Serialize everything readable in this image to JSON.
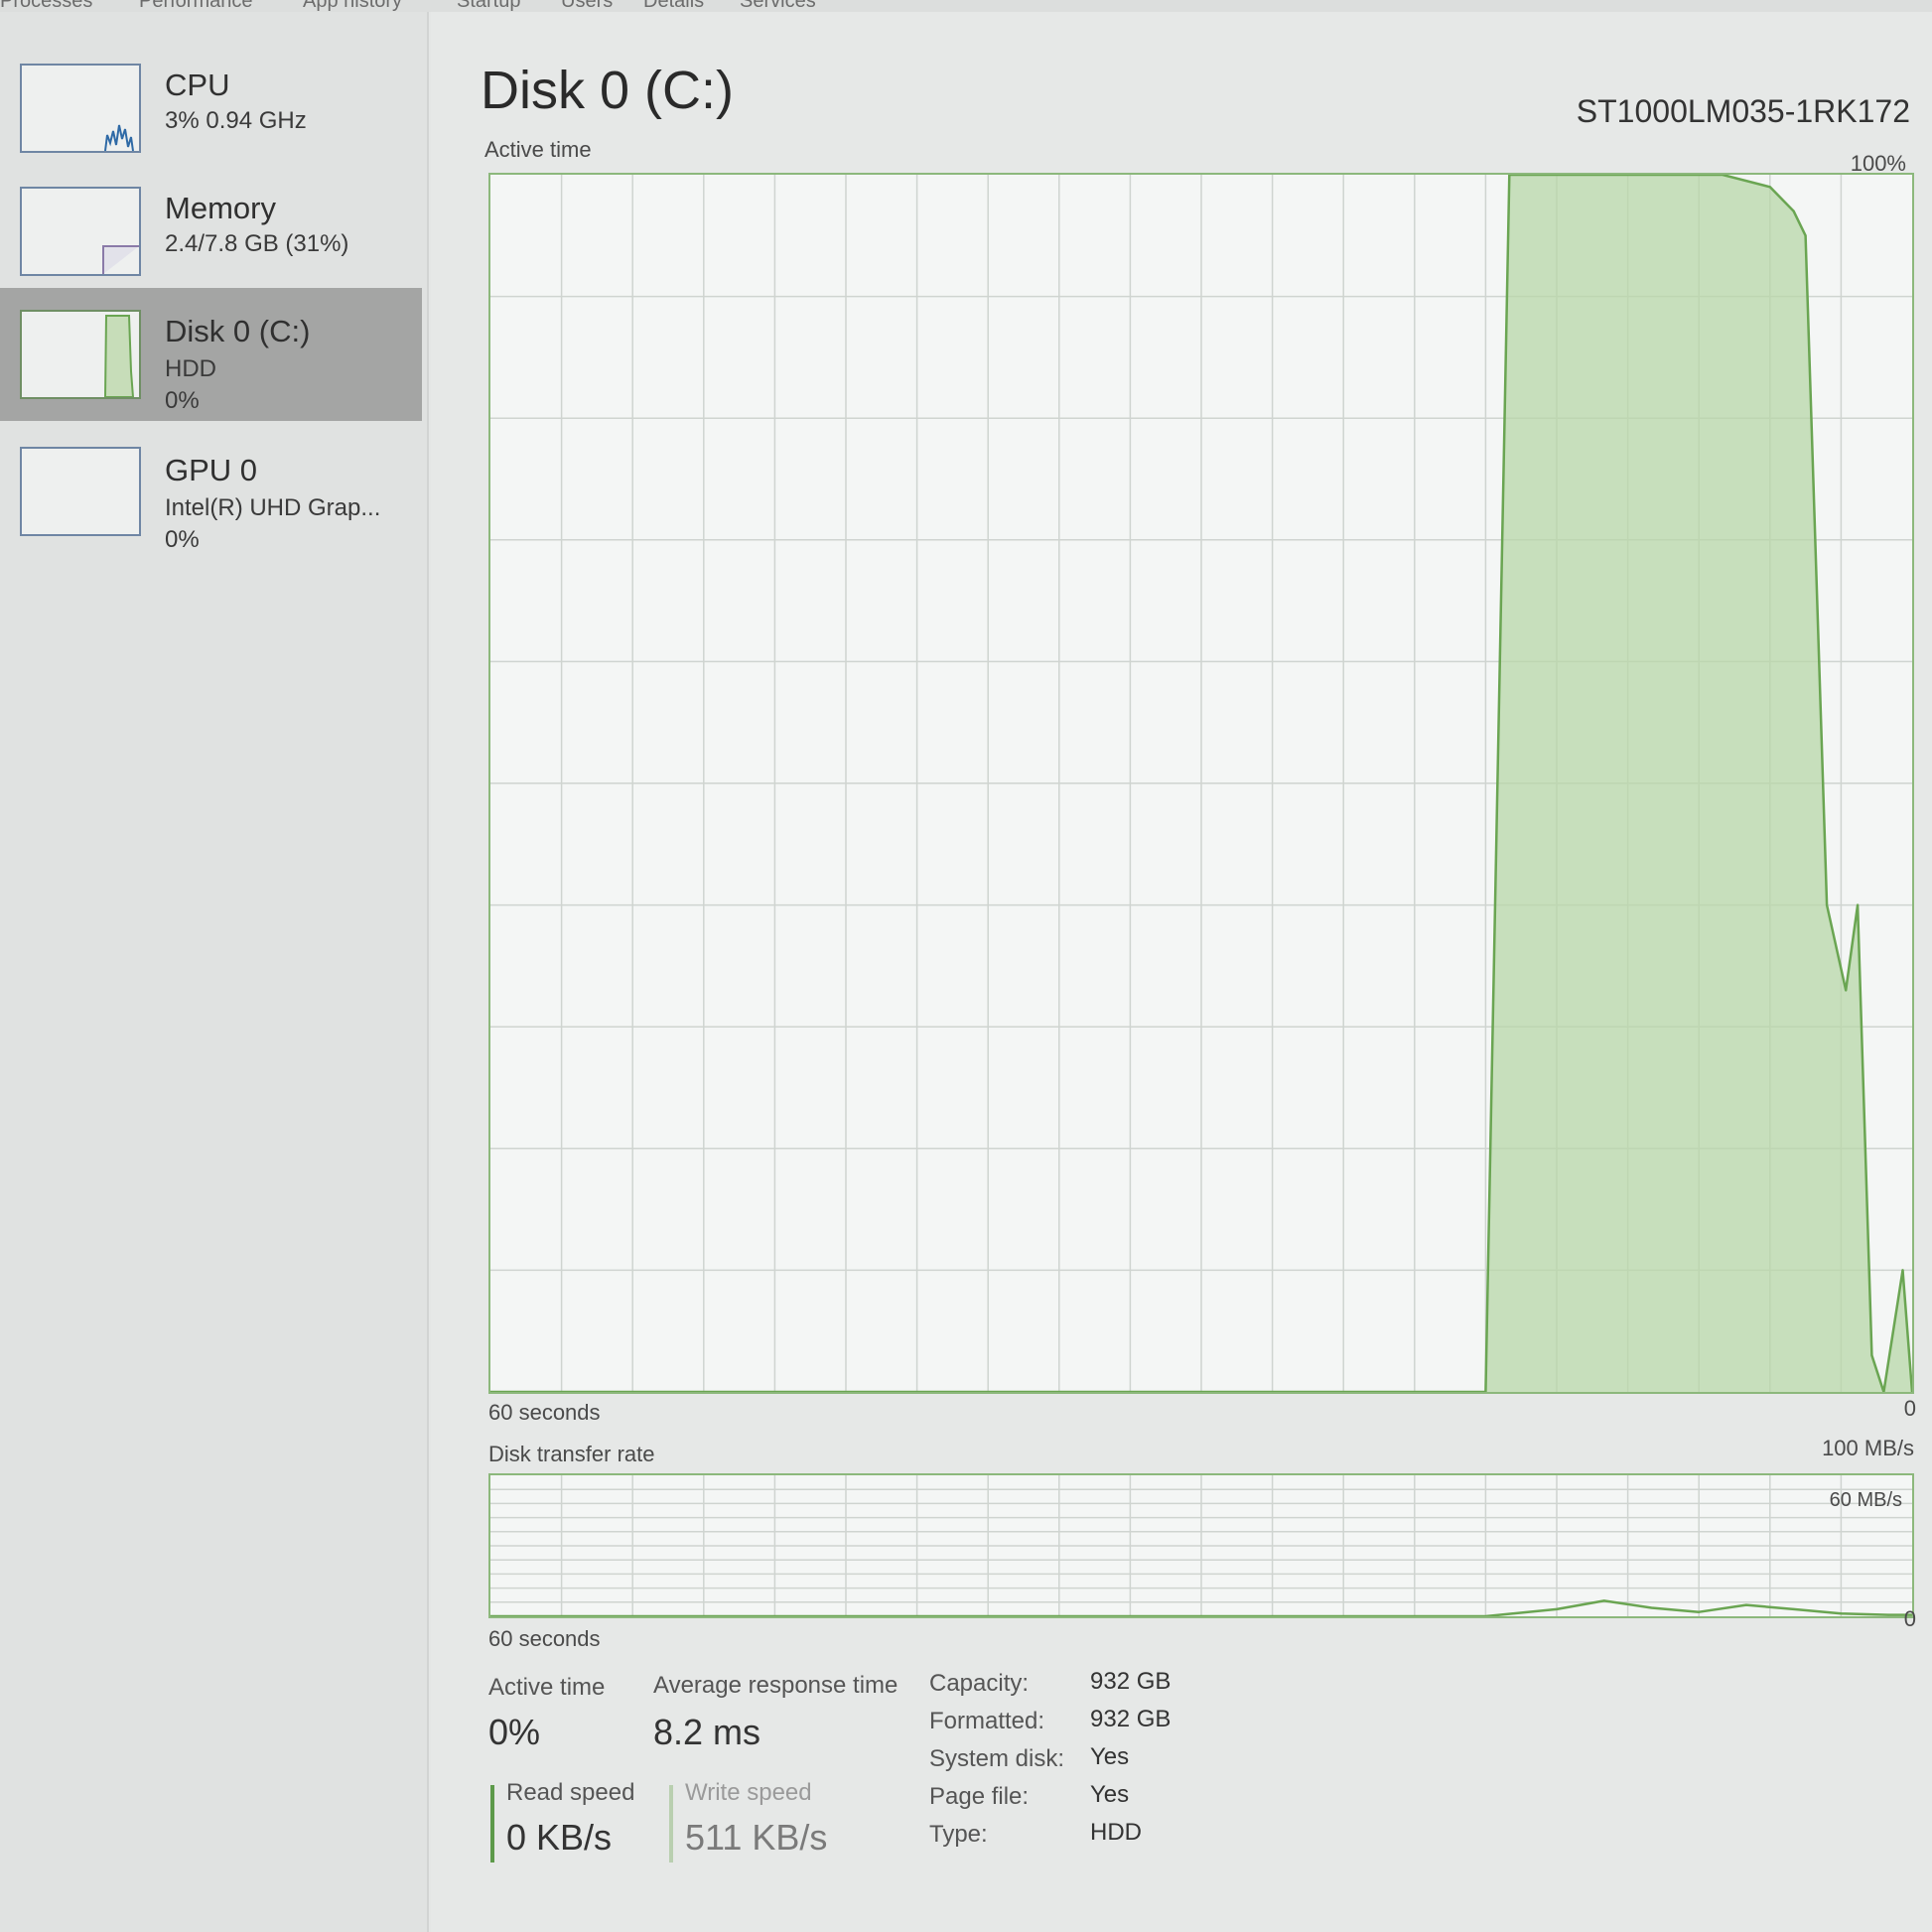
{
  "tabs": [
    "Processes",
    "Performance",
    "App history",
    "Startup",
    "Users",
    "Details",
    "Services"
  ],
  "sidebar": {
    "items": [
      {
        "title": "CPU",
        "sub1": "3% 0.94 GHz",
        "sub2": ""
      },
      {
        "title": "Memory",
        "sub1": "2.4/7.8 GB (31%)",
        "sub2": ""
      },
      {
        "title": "Disk 0 (C:)",
        "sub1": "HDD",
        "sub2": "0%"
      },
      {
        "title": "GPU 0",
        "sub1": "Intel(R) UHD Grap...",
        "sub2": "0%"
      }
    ],
    "selected_index": 2
  },
  "main": {
    "title": "Disk 0 (C:)",
    "model": "ST1000LM035-1RK172",
    "active_graph": {
      "label": "Active time",
      "max_label": "100%",
      "time_label": "60 seconds",
      "min_label": "0"
    },
    "transfer_graph": {
      "label": "Disk transfer rate",
      "max_label": "100 MB/s",
      "mid_label": "60 MB/s",
      "time_label": "60 seconds",
      "min_label": "0"
    }
  },
  "stats": {
    "active_time_label": "Active time",
    "active_time_value": "0%",
    "avg_response_label": "Average response time",
    "avg_response_value": "8.2 ms",
    "read_label": "Read speed",
    "read_value": "0 KB/s",
    "write_label": "Write speed",
    "write_value": "511 KB/s"
  },
  "properties": [
    {
      "key": "Capacity:",
      "value": "932 GB"
    },
    {
      "key": "Formatted:",
      "value": "932 GB"
    },
    {
      "key": "System disk:",
      "value": "Yes"
    },
    {
      "key": "Page file:",
      "value": "Yes"
    },
    {
      "key": "Type:",
      "value": "HDD"
    }
  ],
  "chart_data": [
    {
      "type": "area",
      "title": "Active time",
      "xlabel": "60 seconds",
      "ylabel": "",
      "xlim": [
        60,
        0
      ],
      "ylim": [
        0,
        100
      ],
      "grid": true,
      "x": [
        60,
        18,
        17,
        8,
        6,
        5,
        4.5,
        3.6,
        2.8,
        2.3,
        1.7,
        1.2,
        0.4,
        0
      ],
      "series": [
        {
          "values": [
            0,
            0,
            100,
            100,
            99,
            97,
            95,
            40,
            33,
            40,
            3,
            0,
            10,
            0
          ]
        }
      ]
    },
    {
      "type": "line",
      "title": "Disk transfer rate",
      "xlabel": "60 seconds",
      "ylabel": "",
      "xlim": [
        60,
        0
      ],
      "ylim": [
        0,
        100
      ],
      "grid": true,
      "x": [
        60,
        18,
        15,
        13,
        11,
        9,
        7,
        5,
        3,
        1,
        0
      ],
      "series": [
        {
          "values": [
            0,
            0,
            5,
            11,
            6,
            3,
            8,
            5,
            2,
            1,
            1
          ]
        }
      ]
    }
  ],
  "colors": {
    "graph_border": "#8cb87c",
    "graph_line": "#6aa552",
    "graph_fill": "#b8d7a8",
    "grid": "#cfd4d0",
    "selected_bg": "#a4a5a4",
    "thumb_border": "#6f86a4"
  }
}
